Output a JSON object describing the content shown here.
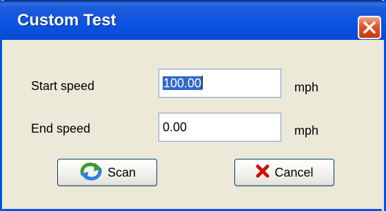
{
  "window": {
    "title": "Custom Test"
  },
  "form": {
    "start_speed": {
      "label": "Start speed",
      "value": "100.00",
      "unit": "mph"
    },
    "end_speed": {
      "label": "End speed",
      "value": "0.00",
      "unit": "mph"
    }
  },
  "buttons": {
    "scan_label": "Scan",
    "cancel_label": "Cancel"
  },
  "icons": {
    "close": "close-icon",
    "scan": "refresh-arrows-icon",
    "cancel": "red-x-icon"
  },
  "colors": {
    "title_bar": "#0a54e3",
    "close_button": "#e2522b",
    "dialog_bg": "#ece9d8",
    "selection": "#316ac5"
  }
}
